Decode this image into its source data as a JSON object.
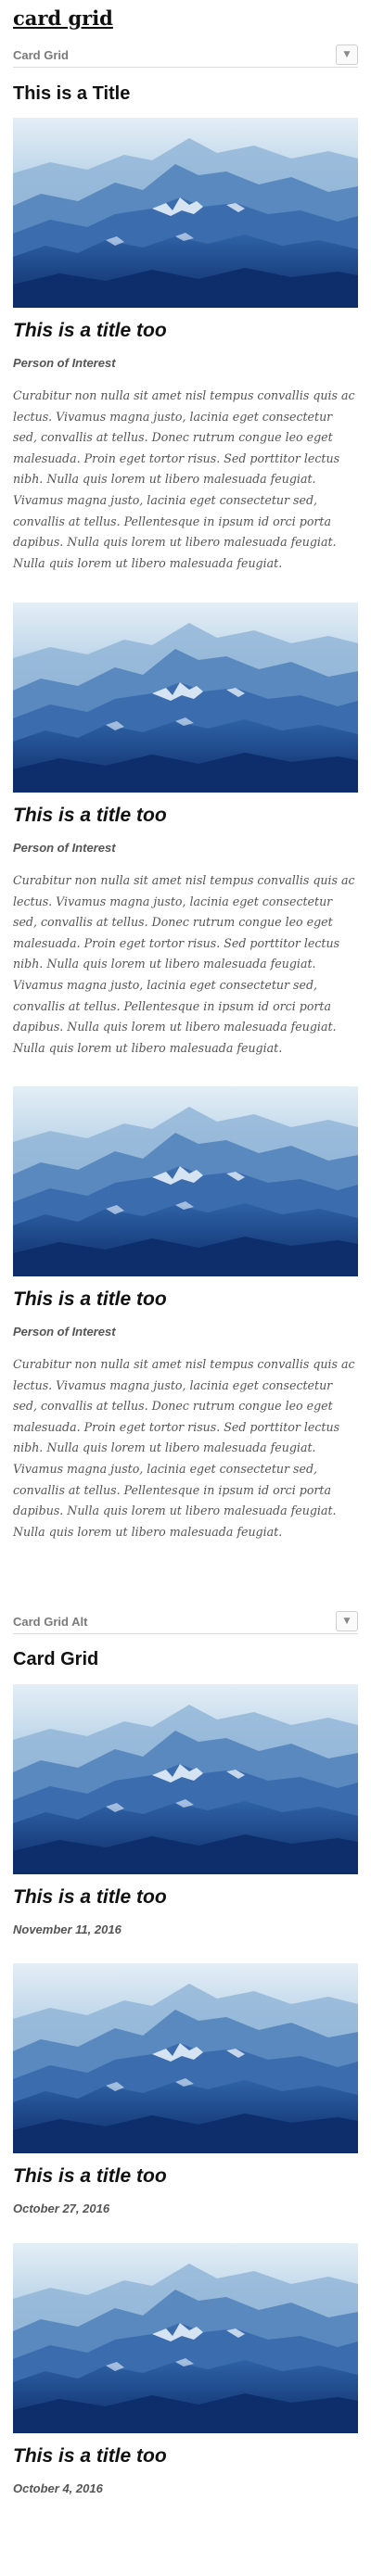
{
  "page": {
    "title": "card grid"
  },
  "section_1": {
    "label": "Card Grid",
    "toggle_glyph": "▼",
    "heading": "This is a Title",
    "cards": [
      {
        "image_alt": "mountain-landscape",
        "title": "This is a title too",
        "subtitle": "Person of Interest",
        "body": "Curabitur non nulla sit amet nisl tempus convallis quis ac lectus. Vivamus magna justo, lacinia eget consectetur sed, convallis at tellus. Donec rutrum congue leo eget malesuada. Proin eget tortor risus. Sed porttitor lectus nibh. Nulla quis lorem ut libero malesuada feugiat. Vivamus magna justo, lacinia eget consectetur sed, convallis at tellus. Pellentesque in ipsum id orci porta dapibus. Nulla quis lorem ut libero malesuada feugiat. Nulla quis lorem ut libero malesuada feugiat."
      },
      {
        "image_alt": "mountain-landscape",
        "title": "This is a title too",
        "subtitle": "Person of Interest",
        "body": "Curabitur non nulla sit amet nisl tempus convallis quis ac lectus. Vivamus magna justo, lacinia eget consectetur sed, convallis at tellus. Donec rutrum congue leo eget malesuada. Proin eget tortor risus. Sed porttitor lectus nibh. Nulla quis lorem ut libero malesuada feugiat. Vivamus magna justo, lacinia eget consectetur sed, convallis at tellus. Pellentesque in ipsum id orci porta dapibus. Nulla quis lorem ut libero malesuada feugiat. Nulla quis lorem ut libero malesuada feugiat."
      },
      {
        "image_alt": "mountain-landscape",
        "title": "This is a title too",
        "subtitle": "Person of Interest",
        "body": "Curabitur non nulla sit amet nisl tempus convallis quis ac lectus. Vivamus magna justo, lacinia eget consectetur sed, convallis at tellus. Donec rutrum congue leo eget malesuada. Proin eget tortor risus. Sed porttitor lectus nibh. Nulla quis lorem ut libero malesuada feugiat. Vivamus magna justo, lacinia eget consectetur sed, convallis at tellus. Pellentesque in ipsum id orci porta dapibus. Nulla quis lorem ut libero malesuada feugiat. Nulla quis lorem ut libero malesuada feugiat."
      }
    ]
  },
  "section_2": {
    "label": "Card Grid Alt",
    "toggle_glyph": "▼",
    "heading": "Card Grid",
    "cards": [
      {
        "image_alt": "mountain-landscape",
        "title": "This is a title too",
        "date": "November 11, 2016"
      },
      {
        "image_alt": "mountain-landscape",
        "title": "This is a title too",
        "date": "October 27, 2016"
      },
      {
        "image_alt": "mountain-landscape",
        "title": "This is a title too",
        "date": "October 4, 2016"
      }
    ]
  },
  "colors": {
    "sky_top": "#d9e8f3",
    "haze": "#a9c8e2",
    "mountain_far": "#7aa3cc",
    "mountain_mid": "#3f72b0",
    "mountain_near": "#1d4e95",
    "mountain_deep": "#0e2f6e",
    "snow": "#eef5fb"
  }
}
